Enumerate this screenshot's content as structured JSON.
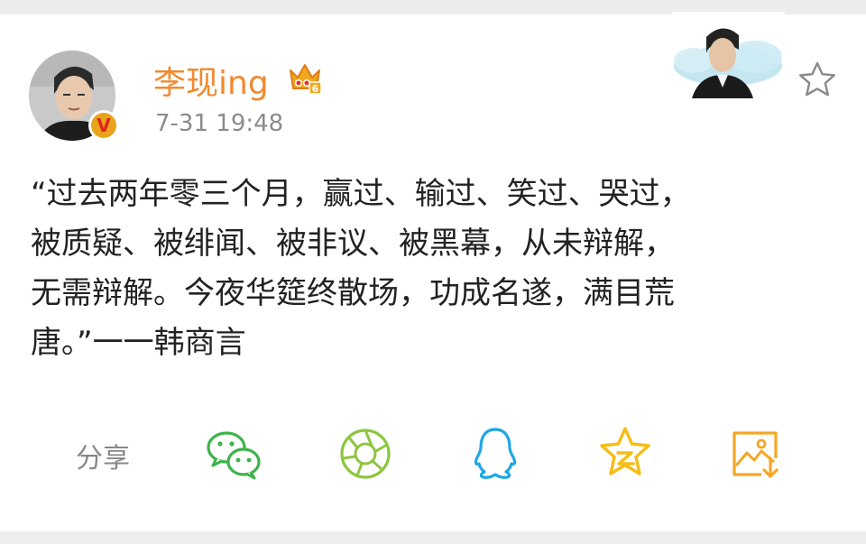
{
  "user": {
    "name": "李现ing",
    "timestamp": "7-31 19:48",
    "verified_badge": "V",
    "level_badge": "6"
  },
  "post": {
    "text": "“过去两年零三个月，赢过、输过、笑过、哭过，\n被质疑、被绯闻、被非议、被黑幕，从未辩解，\n无需辩解。今夜华筵终散场，功成名遂，满目荒\n唐。”一一韩商言"
  },
  "share": {
    "label": "分享",
    "targets": [
      {
        "icon": "wechat-icon",
        "color": "#3db34a"
      },
      {
        "icon": "moments-icon",
        "color": "#8dc63f"
      },
      {
        "icon": "qq-icon",
        "color": "#1ea8e6"
      },
      {
        "icon": "qzone-icon",
        "color": "#f5bd15"
      },
      {
        "icon": "save-image-icon",
        "color": "#f5a623"
      }
    ]
  },
  "colors": {
    "username": "#f08a2e",
    "timestamp": "#8b8b8b",
    "text": "#222222"
  }
}
